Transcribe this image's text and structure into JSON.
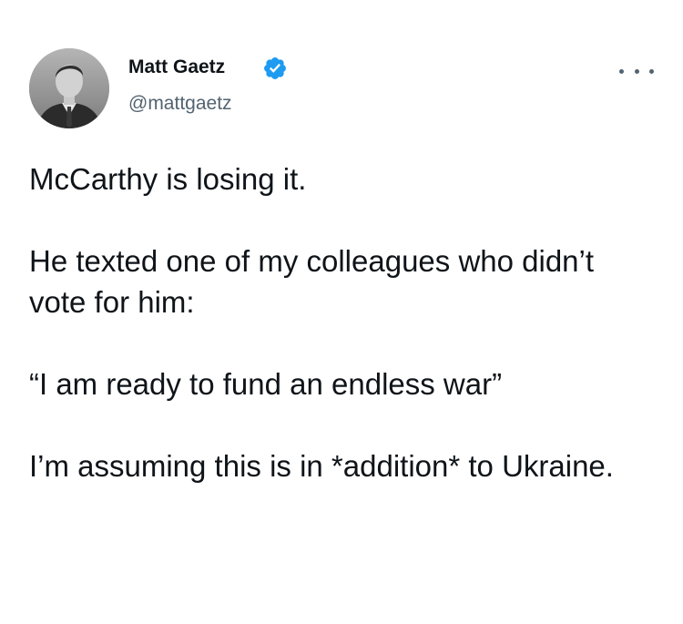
{
  "author": {
    "display_name": "Matt Gaetz",
    "handle": "@mattgaetz",
    "verified": true,
    "avatar_icon": "profile-photo",
    "verified_icon": "verified-badge-icon",
    "more_icon": "more-options-icon"
  },
  "tweet": {
    "paragraphs": [
      "McCarthy is losing it.",
      "He texted one of my colleagues who didn’t vote for him:",
      "“I am ready to fund an endless war”",
      "I’m assuming this is in *addition* to Ukraine."
    ]
  },
  "colors": {
    "text": "#0f1419",
    "secondary_text": "#536471",
    "verified_blue": "#1d9bf0",
    "background": "#ffffff"
  }
}
